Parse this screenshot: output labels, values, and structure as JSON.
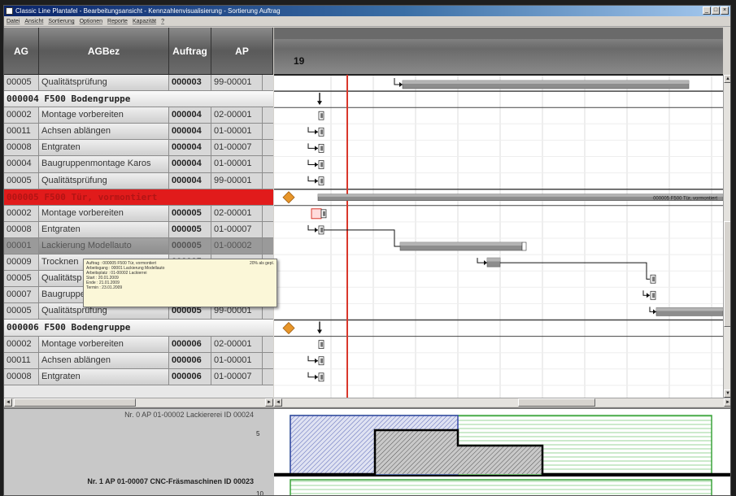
{
  "window": {
    "title": "Classic Line Plantafel - Bearbeitungsansicht - Kennzahlenvisualisierung - Sortierung Auftrag",
    "controls": [
      "_",
      "□",
      "×"
    ]
  },
  "menu": [
    "Datei",
    "Ansicht",
    "Sortierung",
    "Optionen",
    "Reporte",
    "Kapazität",
    "?"
  ],
  "table": {
    "headers": {
      "ag": "AG",
      "agbez": "AGBez",
      "auftrag": "Auftrag",
      "ap": "AP"
    },
    "rows": [
      {
        "type": "op",
        "ag": "00005",
        "bez": "Qualitätsprüfung",
        "auftrag": "000003",
        "ap": "99-00001"
      },
      {
        "type": "group",
        "label": "000004 F500 Bodengruppe"
      },
      {
        "type": "op",
        "ag": "00002",
        "bez": "Montage vorbereiten",
        "auftrag": "000004",
        "ap": "02-00001"
      },
      {
        "type": "op",
        "ag": "00011",
        "bez": "Achsen ablängen",
        "auftrag": "000004",
        "ap": "01-00001"
      },
      {
        "type": "op",
        "ag": "00008",
        "bez": "Entgraten",
        "auftrag": "000004",
        "ap": "01-00007"
      },
      {
        "type": "op",
        "ag": "00004",
        "bez": "Baugruppenmontage Karos",
        "auftrag": "000004",
        "ap": "01-00001"
      },
      {
        "type": "op",
        "ag": "00005",
        "bez": "Qualitätsprüfung",
        "auftrag": "000004",
        "ap": "99-00001"
      },
      {
        "type": "group",
        "label": "000005 F500 Tür, vormontiert",
        "selected": true
      },
      {
        "type": "op",
        "ag": "00002",
        "bez": "Montage vorbereiten",
        "auftrag": "000005",
        "ap": "02-00001"
      },
      {
        "type": "op",
        "ag": "00008",
        "bez": "Entgraten",
        "auftrag": "000005",
        "ap": "01-00007"
      },
      {
        "type": "op",
        "ag": "00001",
        "bez": "Lackierung Modellauto",
        "auftrag": "000005",
        "ap": "01-00002",
        "dark": true
      },
      {
        "type": "op",
        "ag": "00009",
        "bez": "Trocknen",
        "auftrag": "000005",
        "ap": ""
      },
      {
        "type": "op",
        "ag": "00005",
        "bez": "Qualitätsp",
        "auftrag": "000005",
        "ap": ""
      },
      {
        "type": "op",
        "ag": "00007",
        "bez": "Baugruppe",
        "auftrag": "000005",
        "ap": ""
      },
      {
        "type": "op",
        "ag": "00005",
        "bez": "Qualitätsprüfung",
        "auftrag": "000005",
        "ap": "99-00001"
      },
      {
        "type": "group",
        "label": "000006 F500 Bodengruppe"
      },
      {
        "type": "op",
        "ag": "00002",
        "bez": "Montage vorbereiten",
        "auftrag": "000006",
        "ap": "02-00001"
      },
      {
        "type": "op",
        "ag": "00011",
        "bez": "Achsen ablängen",
        "auftrag": "000006",
        "ap": "01-00001"
      },
      {
        "type": "op",
        "ag": "00008",
        "bez": "Entgraten",
        "auftrag": "000006",
        "ap": "01-00007"
      }
    ]
  },
  "tooltip": {
    "lines": [
      "Auftrag        : 000005 F500 Tür, vormontiert",
      "Arbeitsgang    : 00001  Lackierung Modellauto",
      "Arbeitsplatz   : 01-00002  Lackierrei",
      "Start          : 20.01.2009",
      "Ende           : 21.01.2009",
      "Termin         : 23.01.2009"
    ],
    "right": "20% als gepl."
  },
  "gantt": {
    "day_label": "19",
    "order_bar_label": "000005 F500 Tür, vormontiert"
  },
  "resources": [
    {
      "label": "Nr. 0  AP 01-00002  Lackiererei  ID 00024",
      "tick": "5"
    },
    {
      "label": "Nr. 1  AP 01-00007  CNC-Fräsmaschinen  ID 00023",
      "tick": "10"
    }
  ],
  "colors": {
    "selection": "#e11b1b",
    "today_line": "#d9372b",
    "milestone": "#e8962a",
    "capacity_green": "#3aa33a",
    "capacity_blue": "#3547a8"
  }
}
